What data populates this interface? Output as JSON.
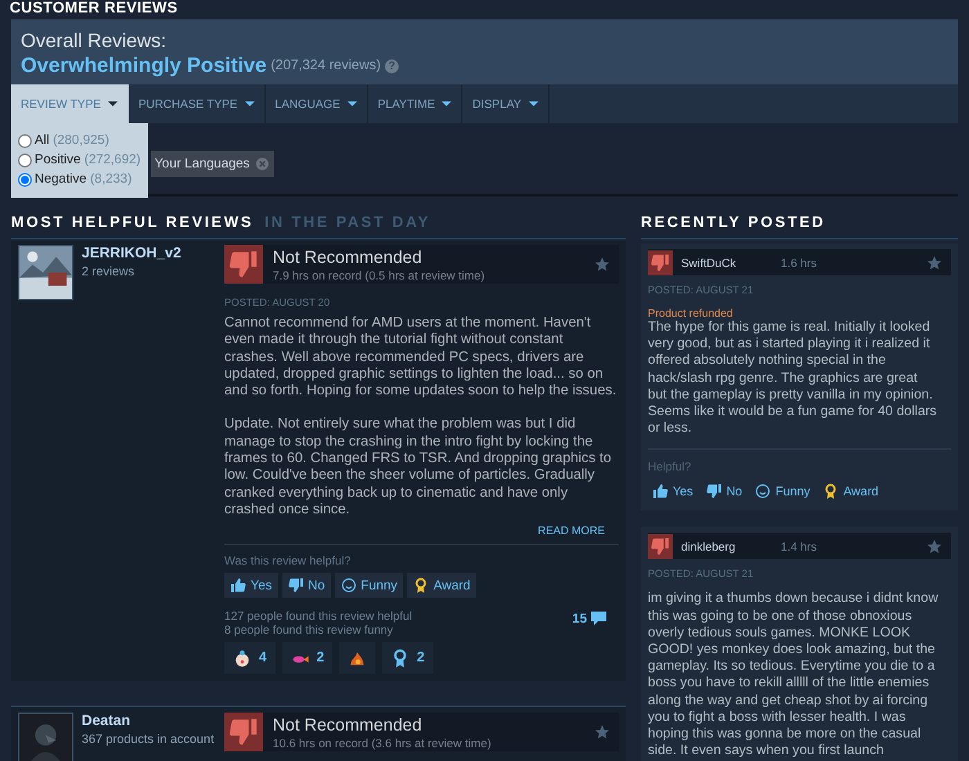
{
  "section_title": "CUSTOMER REVIEWS",
  "summary": {
    "label": "Overall Reviews:",
    "rating": "Overwhelmingly Positive",
    "count": "(207,324 reviews)",
    "help": "?"
  },
  "filters": [
    {
      "label": "REVIEW TYPE",
      "selected": true
    },
    {
      "label": "PURCHASE TYPE",
      "selected": false
    },
    {
      "label": "LANGUAGE",
      "selected": false
    },
    {
      "label": "PLAYTIME",
      "selected": false
    },
    {
      "label": "DISPLAY",
      "selected": false
    }
  ],
  "review_type_options": [
    {
      "label": "All",
      "count": "(280,925)",
      "selected": false
    },
    {
      "label": "Positive",
      "count": "(272,692)",
      "selected": false
    },
    {
      "label": "Negative",
      "count": "(8,233)",
      "selected": true
    }
  ],
  "active_filters": [
    {
      "label": "Your Languages"
    }
  ],
  "helpful": {
    "title": "MOST HELPFUL REVIEWS",
    "subtitle": "IN THE PAST DAY",
    "reviews": [
      {
        "author": "JERRIKOH_v2",
        "author_info": "2 reviews",
        "verdict": "Not Recommended",
        "hours": "7.9 hrs on record (0.5 hrs at review time)",
        "posted": "POSTED: AUGUST 20",
        "paragraphs": [
          "Cannot recommend for AMD users at the moment. Haven't even made it through the tutorial fight without constant crashes. Well above recommended PC specs, drivers are updated, dropped graphic settings to lighten the load... so on and so forth. Hoping for some updates soon to help the issues.",
          "Update. Not entirely sure what the problem was but I did manage to stop the crashing in the intro fight by locking the frames to 60. Changed FRS to TSR. And dropping graphics to low. Could've been the sheer volume of particles. Gradually cranked everything back up to cinematic and have only crashed once since."
        ],
        "read_more": "READ MORE",
        "helpful_prompt": "Was this review helpful?",
        "votes": [
          {
            "kind": "yes",
            "label": "Yes"
          },
          {
            "kind": "no",
            "label": "No"
          },
          {
            "kind": "funny",
            "label": "Funny"
          },
          {
            "kind": "award",
            "label": "Award"
          }
        ],
        "helpful_count": "127 people found this review helpful",
        "funny_count": "8 people found this review funny",
        "comments": "15",
        "awards": [
          {
            "kind": "clown",
            "count": "4"
          },
          {
            "kind": "fish",
            "count": "2"
          },
          {
            "kind": "fire"
          },
          {
            "kind": "ribbon",
            "count": "2"
          }
        ]
      },
      {
        "author": "Deatan",
        "author_info": "367 products in account",
        "verdict": "Not Recommended",
        "hours": "10.6 hrs on record (3.6 hrs at review time)"
      }
    ]
  },
  "recent": {
    "title": "RECENTLY POSTED",
    "reviews": [
      {
        "author": "SwiftDuCk",
        "hours": "1.6 hrs",
        "posted": "POSTED: AUGUST 21",
        "note": "Product refunded",
        "text": "The hype for this game is real. Initially it looked very good, but as i started playing it i realized it offered absolutely nothing special in the hack/slash rpg genre. The graphics are great but the gameplay is pretty vanilla in my opinion. Seems like it would be a fun game for 40 dollars or less.",
        "helpful_prompt": "Helpful?",
        "votes": [
          {
            "kind": "yes",
            "label": "Yes"
          },
          {
            "kind": "no",
            "label": "No"
          },
          {
            "kind": "funny",
            "label": "Funny"
          },
          {
            "kind": "award",
            "label": "Award"
          }
        ]
      },
      {
        "author": "dinkleberg",
        "hours": "1.4 hrs",
        "posted": "POSTED: AUGUST 21",
        "text": "im giving it a thumbs down because i didnt know this was going to be one of those obnoxious overly tedious souls games. MONKE LOOK GOOD! yes monkey does look amazing, but the gameplay. Its so tedious. Everytime you die to a boss you have to rekill alllll of the little enemies along the way and get cheap shot by ai forcing you to fight a boss with lesser health. I was hoping this was gonna be more on the casual side. It even says when you first launch"
      }
    ]
  }
}
